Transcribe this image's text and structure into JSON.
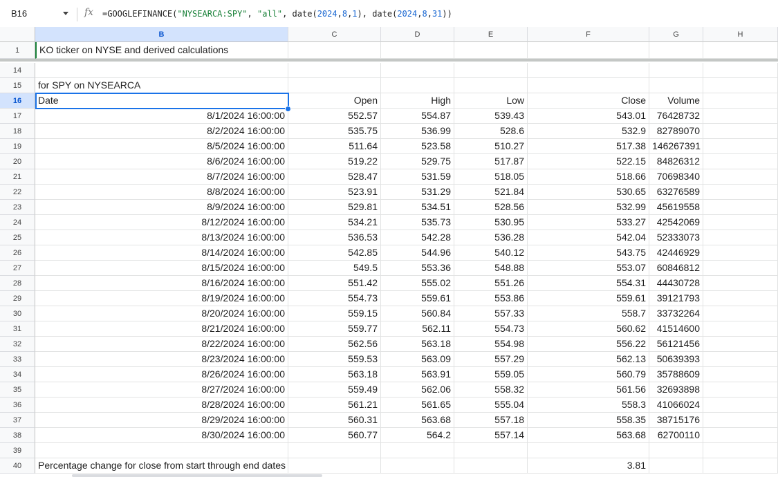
{
  "formula_bar": {
    "cell_ref": "B16",
    "fx": "fx",
    "formula_parts": [
      {
        "t": "=GOOGLEFINANCE(",
        "k": "def"
      },
      {
        "t": "\"NYSEARCA:SPY\"",
        "k": "str"
      },
      {
        "t": ", ",
        "k": "def"
      },
      {
        "t": "\"all\"",
        "k": "str"
      },
      {
        "t": ", date(",
        "k": "def"
      },
      {
        "t": "2024",
        "k": "num"
      },
      {
        "t": ",",
        "k": "def"
      },
      {
        "t": "8",
        "k": "num"
      },
      {
        "t": ",",
        "k": "def"
      },
      {
        "t": "1",
        "k": "num"
      },
      {
        "t": "), date(",
        "k": "def"
      },
      {
        "t": "2024",
        "k": "num"
      },
      {
        "t": ",",
        "k": "def"
      },
      {
        "t": "8",
        "k": "num"
      },
      {
        "t": ",",
        "k": "def"
      },
      {
        "t": "31",
        "k": "num"
      },
      {
        "t": "))",
        "k": "def"
      }
    ]
  },
  "columns": [
    "B",
    "C",
    "D",
    "E",
    "F",
    "G",
    "H"
  ],
  "selected_column": "B",
  "selected_row": "16",
  "row1": {
    "num": "1",
    "text": "KO ticker on NYSE and derived calculations"
  },
  "rows_gap": [
    {
      "num": "14"
    }
  ],
  "row15": {
    "num": "15",
    "text": "for SPY on NYSEARCA"
  },
  "header_row": {
    "num": "16",
    "date": "Date",
    "open": "Open",
    "high": "High",
    "low": "Low",
    "close": "Close",
    "volume": "Volume"
  },
  "data_rows": [
    {
      "num": "17",
      "date": "8/1/2024 16:00:00",
      "open": "552.57",
      "high": "554.87",
      "low": "539.43",
      "close": "543.01",
      "volume": "76428732"
    },
    {
      "num": "18",
      "date": "8/2/2024 16:00:00",
      "open": "535.75",
      "high": "536.99",
      "low": "528.6",
      "close": "532.9",
      "volume": "82789070"
    },
    {
      "num": "19",
      "date": "8/5/2024 16:00:00",
      "open": "511.64",
      "high": "523.58",
      "low": "510.27",
      "close": "517.38",
      "volume": "146267391"
    },
    {
      "num": "20",
      "date": "8/6/2024 16:00:00",
      "open": "519.22",
      "high": "529.75",
      "low": "517.87",
      "close": "522.15",
      "volume": "84826312"
    },
    {
      "num": "21",
      "date": "8/7/2024 16:00:00",
      "open": "528.47",
      "high": "531.59",
      "low": "518.05",
      "close": "518.66",
      "volume": "70698340"
    },
    {
      "num": "22",
      "date": "8/8/2024 16:00:00",
      "open": "523.91",
      "high": "531.29",
      "low": "521.84",
      "close": "530.65",
      "volume": "63276589"
    },
    {
      "num": "23",
      "date": "8/9/2024 16:00:00",
      "open": "529.81",
      "high": "534.51",
      "low": "528.56",
      "close": "532.99",
      "volume": "45619558"
    },
    {
      "num": "24",
      "date": "8/12/2024 16:00:00",
      "open": "534.21",
      "high": "535.73",
      "low": "530.95",
      "close": "533.27",
      "volume": "42542069"
    },
    {
      "num": "25",
      "date": "8/13/2024 16:00:00",
      "open": "536.53",
      "high": "542.28",
      "low": "536.28",
      "close": "542.04",
      "volume": "52333073"
    },
    {
      "num": "26",
      "date": "8/14/2024 16:00:00",
      "open": "542.85",
      "high": "544.96",
      "low": "540.12",
      "close": "543.75",
      "volume": "42446929"
    },
    {
      "num": "27",
      "date": "8/15/2024 16:00:00",
      "open": "549.5",
      "high": "553.36",
      "low": "548.88",
      "close": "553.07",
      "volume": "60846812"
    },
    {
      "num": "28",
      "date": "8/16/2024 16:00:00",
      "open": "551.42",
      "high": "555.02",
      "low": "551.26",
      "close": "554.31",
      "volume": "44430728"
    },
    {
      "num": "29",
      "date": "8/19/2024 16:00:00",
      "open": "554.73",
      "high": "559.61",
      "low": "553.86",
      "close": "559.61",
      "volume": "39121793"
    },
    {
      "num": "30",
      "date": "8/20/2024 16:00:00",
      "open": "559.15",
      "high": "560.84",
      "low": "557.33",
      "close": "558.7",
      "volume": "33732264"
    },
    {
      "num": "31",
      "date": "8/21/2024 16:00:00",
      "open": "559.77",
      "high": "562.11",
      "low": "554.73",
      "close": "560.62",
      "volume": "41514600"
    },
    {
      "num": "32",
      "date": "8/22/2024 16:00:00",
      "open": "562.56",
      "high": "563.18",
      "low": "554.98",
      "close": "556.22",
      "volume": "56121456"
    },
    {
      "num": "33",
      "date": "8/23/2024 16:00:00",
      "open": "559.53",
      "high": "563.09",
      "low": "557.29",
      "close": "562.13",
      "volume": "50639393"
    },
    {
      "num": "34",
      "date": "8/26/2024 16:00:00",
      "open": "563.18",
      "high": "563.91",
      "low": "559.05",
      "close": "560.79",
      "volume": "35788609"
    },
    {
      "num": "35",
      "date": "8/27/2024 16:00:00",
      "open": "559.49",
      "high": "562.06",
      "low": "558.32",
      "close": "561.56",
      "volume": "32693898"
    },
    {
      "num": "36",
      "date": "8/28/2024 16:00:00",
      "open": "561.21",
      "high": "561.65",
      "low": "555.04",
      "close": "558.3",
      "volume": "41066024"
    },
    {
      "num": "37",
      "date": "8/29/2024 16:00:00",
      "open": "560.31",
      "high": "563.68",
      "low": "557.18",
      "close": "558.35",
      "volume": "38715176"
    },
    {
      "num": "38",
      "date": "8/30/2024 16:00:00",
      "open": "560.77",
      "high": "564.2",
      "low": "557.14",
      "close": "563.68",
      "volume": "62700110"
    }
  ],
  "row39": {
    "num": "39"
  },
  "row40": {
    "num": "40",
    "text": "Percentage change for close from start through end dates",
    "value": "3.81"
  },
  "colors": {
    "selection": "#1a73e8",
    "header_bg": "#f8f9fa",
    "selected_header_bg": "#d3e3fd",
    "formula_string": "#188038",
    "formula_number": "#1967d2"
  }
}
